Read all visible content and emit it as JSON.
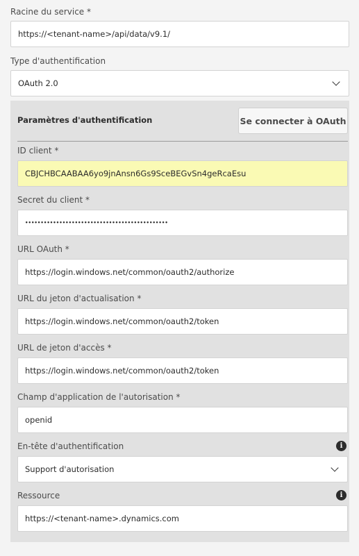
{
  "service_root": {
    "label": "Racine du service *",
    "value": "https://<tenant-name>/api/data/v9.1/"
  },
  "auth_type": {
    "label": "Type d'authentification",
    "value": "OAuth 2.0"
  },
  "auth_params": {
    "title": "Paramètres d'authentification",
    "connect_button": "Se connecter à OAuth",
    "client_id": {
      "label": "ID client *",
      "value": "CBJCHBCAABAA6yo9jnAnsn6Gs9SceBEGvSn4geRcaEsu"
    },
    "client_secret": {
      "label": "Secret du client *",
      "value": "••••••••••••••••••••••••••••••••••••••••••••••"
    },
    "oauth_url": {
      "label": "URL OAuth *",
      "value": "https://login.windows.net/common/oauth2/authorize"
    },
    "refresh_token_url": {
      "label": "URL du jeton d'actualisation *",
      "value": "https://login.windows.net/common/oauth2/token"
    },
    "access_token_url": {
      "label": "URL de jeton d'accès *",
      "value": "https://login.windows.net/common/oauth2/token"
    },
    "scope": {
      "label": "Champ d'application de l'autorisation *",
      "value": "openid"
    },
    "auth_header": {
      "label": "En-tête d'authentification",
      "value": "Support d'autorisation",
      "info_icon": "info-icon"
    },
    "resource": {
      "label": "Ressource",
      "value": "https://<tenant-name>.dynamics.com",
      "info_icon": "info-icon"
    }
  },
  "colors": {
    "highlight": "#fafab4",
    "panel": "#e1e1e1",
    "background": "#f4f4f4"
  }
}
